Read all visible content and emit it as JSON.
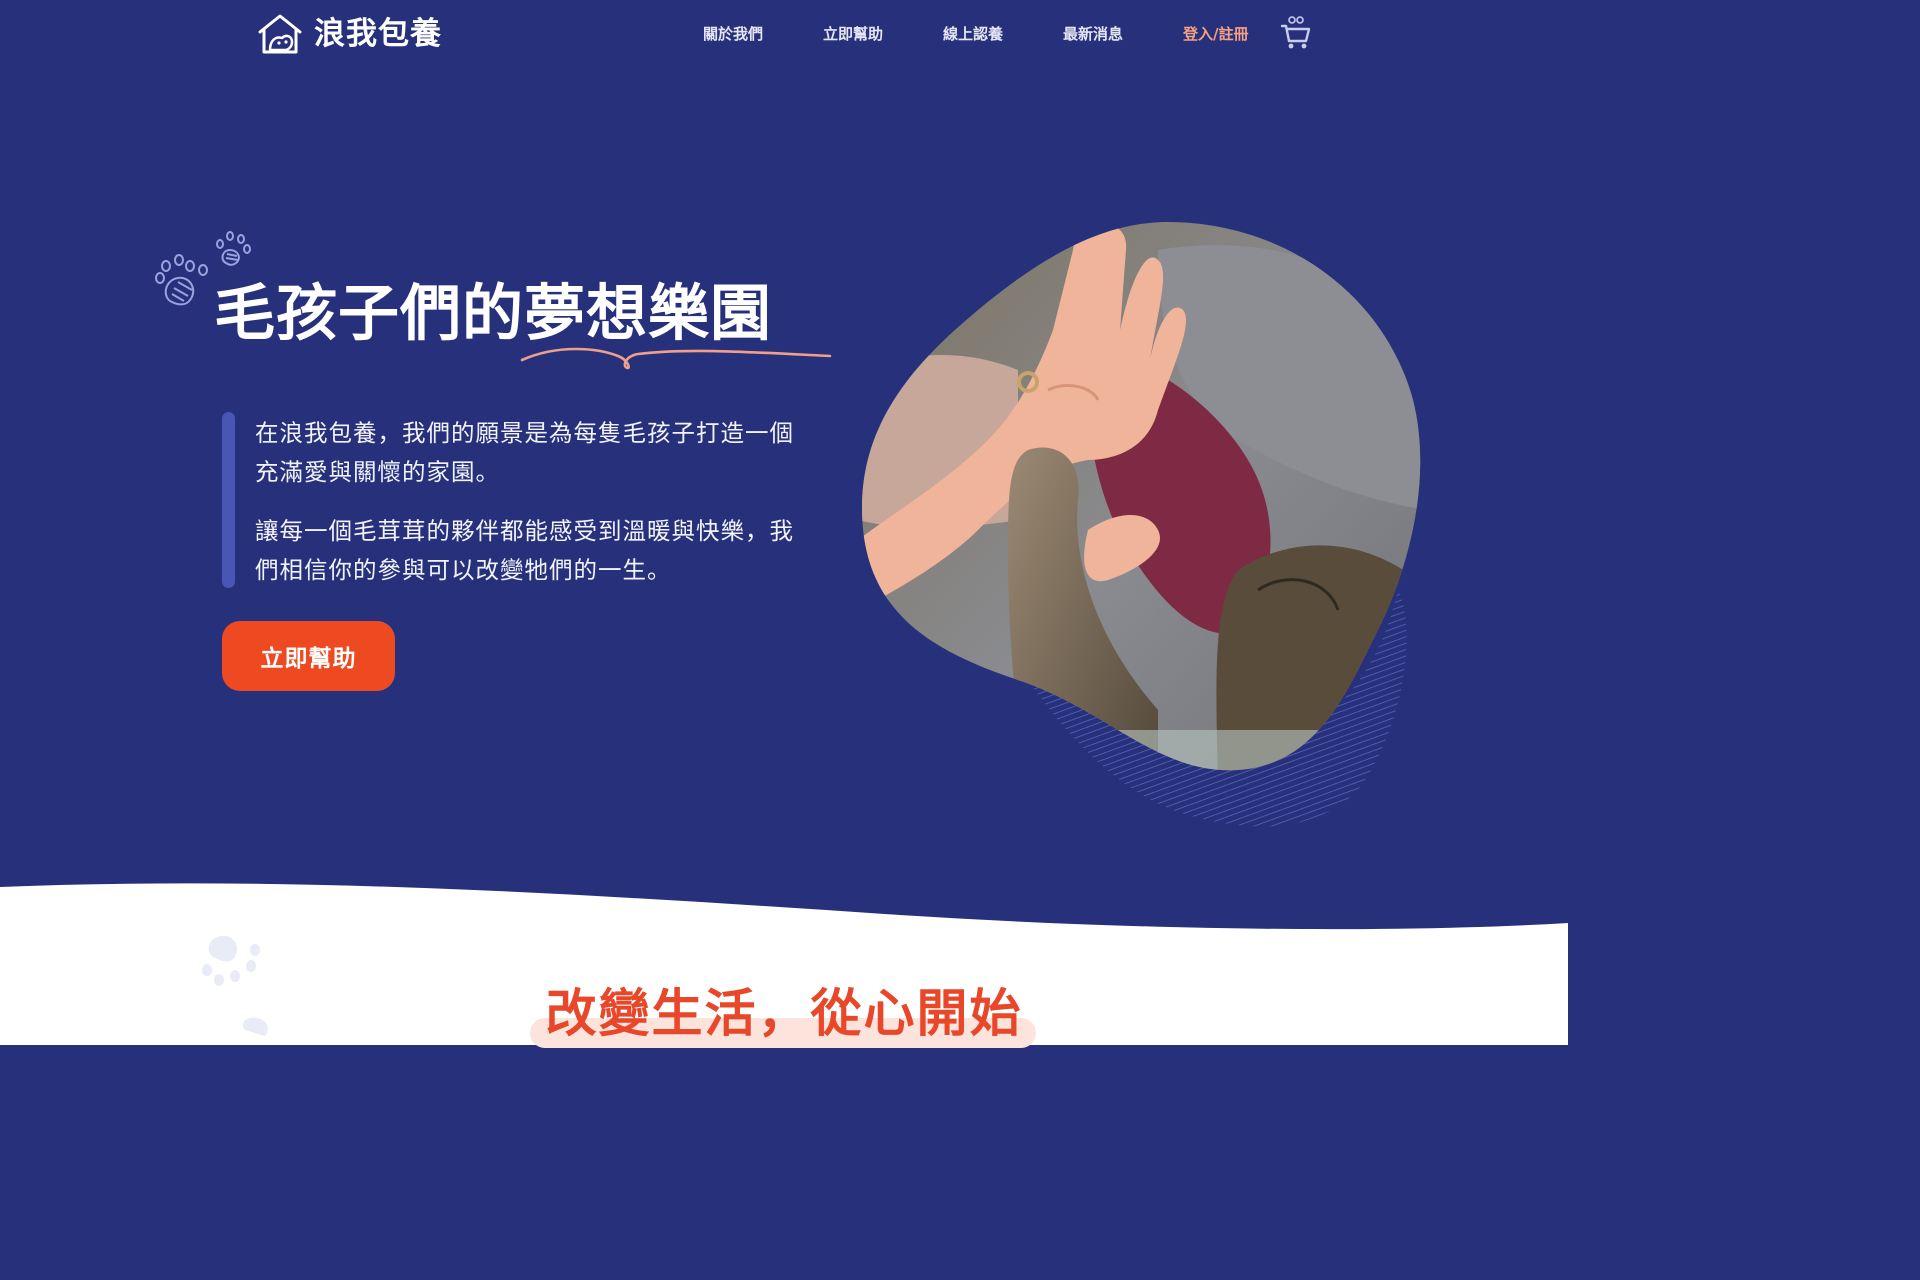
{
  "brand": {
    "name": "浪我包養",
    "logo_icon": "house-pet-icon"
  },
  "nav": {
    "links": [
      "關於我們",
      "立即幫助",
      "線上認養",
      "最新消息"
    ],
    "login": "登入/註冊",
    "cart_icon": "cart-icon"
  },
  "hero": {
    "title": "毛孩子們的夢想樂園",
    "paragraphs": [
      "在浪我包養，我們的願景是為每隻毛孩子打造一個充滿愛與關懷的家園。",
      "讓每一個毛茸茸的夥伴都能感受到溫暖與快樂，我們相信你的參與可以改變牠們的一生。"
    ],
    "cta": "立即幫助",
    "image": "hand-high-five-cat-paw-photo"
  },
  "section": {
    "title": "改變生活，從心開始"
  },
  "colors": {
    "background": "#27317b",
    "accent_orange": "#ee4a22",
    "login_peach": "#f4a082",
    "underline_pink": "#f0a08a"
  }
}
